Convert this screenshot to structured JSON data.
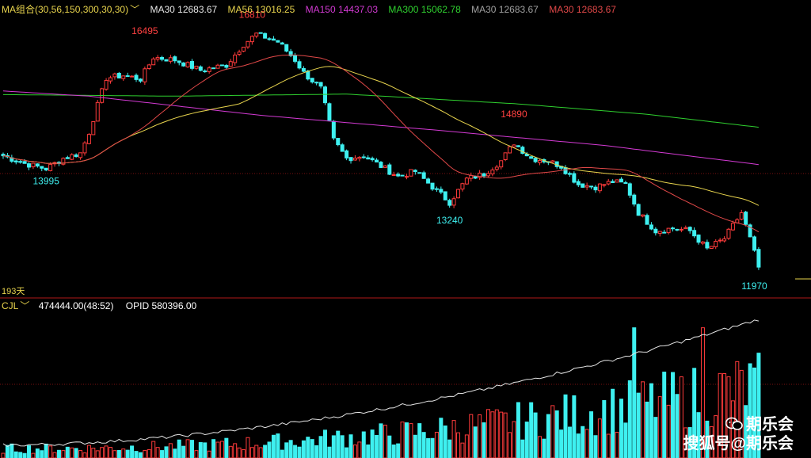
{
  "legend_top": {
    "ma_group": "MA组合(30,56,150,300,30,30)",
    "items": [
      {
        "label": "MA30 12683.67",
        "color": "#e8e8e8"
      },
      {
        "label": "MA56 13016.25",
        "color": "#e8d44d"
      },
      {
        "label": "MA150 14437.03",
        "color": "#d33ad3"
      },
      {
        "label": "MA300 15062.78",
        "color": "#2fd02f"
      },
      {
        "label": "MA30 12683.67",
        "color": "#a0a0a0"
      },
      {
        "label": "MA30 12683.67",
        "color": "#e04848"
      }
    ]
  },
  "legend_bottom": {
    "ind": "CJL",
    "vol": "474444.00(48:52)",
    "opid": "OPID 580396.00"
  },
  "days_label": "193天",
  "watermark": {
    "line1": "期乐会",
    "line2": "搜狐号@期乐会"
  },
  "colors": {
    "up": "#ff3b3b",
    "down": "#3ef0f0",
    "ma30": "#e04848",
    "ma56": "#e8d44d",
    "ma150": "#d33ad3",
    "ma300": "#2fd02f",
    "oi": "#e6e6e6",
    "grid": "#7a1010"
  },
  "chart_data": {
    "type": "candlestick",
    "price_range": [
      11800,
      17000
    ],
    "labels": [
      {
        "i": 10,
        "text": "13995",
        "price": 13995,
        "pos": "below",
        "color": "#3ef0f0"
      },
      {
        "i": 33,
        "text": "16495",
        "price": 16495,
        "pos": "above",
        "color": "#ff4040"
      },
      {
        "i": 58,
        "text": "16810",
        "price": 16810,
        "pos": "above",
        "color": "#ff4040"
      },
      {
        "i": 104,
        "text": "13240",
        "price": 13240,
        "pos": "below",
        "color": "#3ef0f0"
      },
      {
        "i": 119,
        "text": "14890",
        "price": 14890,
        "pos": "above",
        "color": "#ff4040"
      },
      {
        "i": 175,
        "text": "11970",
        "price": 11970,
        "pos": "below",
        "color": "#3ef0f0"
      }
    ],
    "anchors": [
      [
        0,
        14300
      ],
      [
        5,
        14150
      ],
      [
        10,
        14050
      ],
      [
        14,
        14250
      ],
      [
        18,
        14350
      ],
      [
        20,
        14750
      ],
      [
        24,
        15800
      ],
      [
        28,
        15850
      ],
      [
        32,
        15780
      ],
      [
        35,
        16200
      ],
      [
        40,
        16150
      ],
      [
        46,
        15950
      ],
      [
        52,
        16050
      ],
      [
        56,
        16450
      ],
      [
        59,
        16650
      ],
      [
        64,
        16500
      ],
      [
        68,
        16150
      ],
      [
        70,
        15900
      ],
      [
        74,
        15600
      ],
      [
        77,
        14600
      ],
      [
        80,
        14250
      ],
      [
        84,
        14300
      ],
      [
        88,
        14100
      ],
      [
        92,
        13900
      ],
      [
        96,
        14000
      ],
      [
        100,
        13700
      ],
      [
        104,
        13400
      ],
      [
        108,
        13850
      ],
      [
        112,
        13950
      ],
      [
        116,
        14200
      ],
      [
        119,
        14550
      ],
      [
        123,
        14250
      ],
      [
        127,
        14200
      ],
      [
        130,
        14100
      ],
      [
        134,
        13750
      ],
      [
        138,
        13700
      ],
      [
        142,
        13800
      ],
      [
        145,
        13750
      ],
      [
        148,
        13200
      ],
      [
        152,
        12850
      ],
      [
        156,
        12900
      ],
      [
        160,
        12850
      ],
      [
        164,
        12500
      ],
      [
        168,
        12700
      ],
      [
        172,
        13200
      ],
      [
        174,
        12700
      ],
      [
        176,
        12150
      ]
    ],
    "ma_anchors": {
      "ma150": [
        [
          0,
          15550
        ],
        [
          20,
          15450
        ],
        [
          60,
          15080
        ],
        [
          100,
          14800
        ],
        [
          140,
          14500
        ],
        [
          176,
          14130
        ]
      ],
      "ma300": [
        [
          0,
          15480
        ],
        [
          40,
          15450
        ],
        [
          80,
          15490
        ],
        [
          120,
          15300
        ],
        [
          150,
          15100
        ],
        [
          176,
          14850
        ]
      ]
    },
    "volume": {
      "oi_start": 40,
      "oi_end": 430
    }
  }
}
